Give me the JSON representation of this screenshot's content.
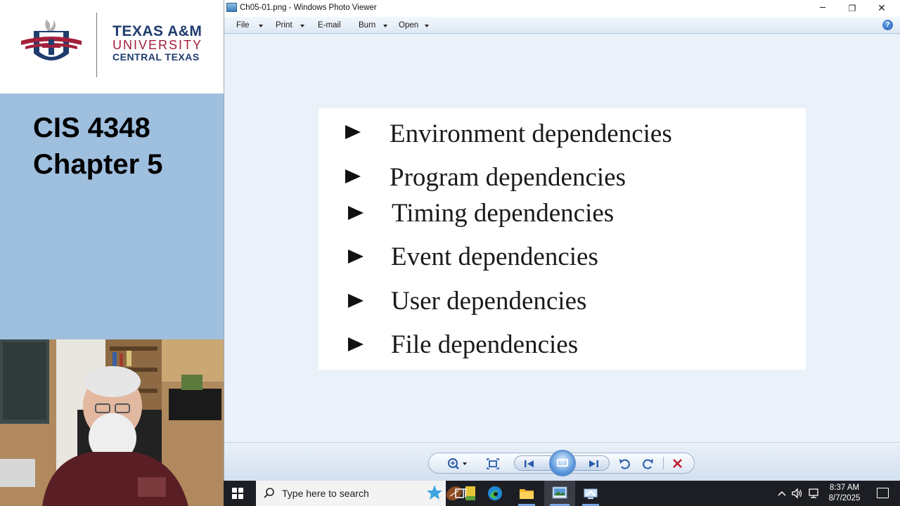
{
  "slide": {
    "logo": {
      "line1": "TEXAS A&M",
      "line2": "UNIVERSITY",
      "line3": "CENTRAL TEXAS"
    },
    "course_title_line1": "CIS 4348",
    "course_title_line2": "Chapter 5",
    "colors": {
      "panel_bg": "#9fbfdf",
      "maroon": "#a3203a",
      "navy": "#1f3c6e"
    }
  },
  "webcam": {
    "icon": "presenter-video-feed"
  },
  "viewer": {
    "window_title": "Ch05-01.png - Windows Photo Viewer",
    "controls": {
      "minimize": "─",
      "restore": "❐",
      "close": "✕"
    },
    "menu": [
      {
        "label": "File",
        "has_dropdown": true
      },
      {
        "label": "Print",
        "has_dropdown": true
      },
      {
        "label": "E-mail",
        "has_dropdown": false
      },
      {
        "label": "Burn",
        "has_dropdown": true
      },
      {
        "label": "Open",
        "has_dropdown": true
      }
    ],
    "help_label": "?",
    "image_content": {
      "items": [
        "Environment dependencies",
        "Program dependencies",
        "Timing dependencies",
        "Event dependencies",
        "User dependencies",
        "File dependencies"
      ]
    },
    "toolbar": {
      "zoom_icon": "zoom-icon",
      "actual_size_icon": "actual-size-icon",
      "previous_icon": "previous-icon",
      "slideshow_icon": "slideshow-icon",
      "next_icon": "next-icon",
      "rotate_ccw_icon": "rotate-counterclockwise-icon",
      "rotate_cw_icon": "rotate-clockwise-icon",
      "delete_icon": "delete-icon",
      "delete_color": "#c0182e"
    }
  },
  "taskbar": {
    "search_placeholder": "Type here to search",
    "clock_time": "8:37 AM",
    "clock_date": "8/7/2025"
  }
}
